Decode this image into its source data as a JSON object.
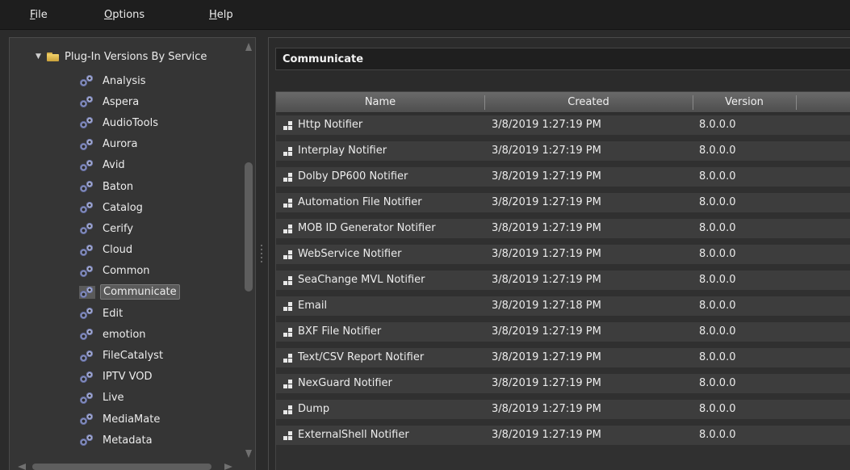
{
  "menu": {
    "file": "F",
    "file_rest": "ile",
    "options": "O",
    "options_rest": "ptions",
    "help": "H",
    "help_rest": "elp"
  },
  "tree": {
    "root_label": "Plug-In Versions By Service",
    "items": [
      {
        "label": "Analysis"
      },
      {
        "label": "Aspera"
      },
      {
        "label": "AudioTools"
      },
      {
        "label": "Aurora"
      },
      {
        "label": "Avid"
      },
      {
        "label": "Baton"
      },
      {
        "label": "Catalog"
      },
      {
        "label": "Cerify"
      },
      {
        "label": "Cloud"
      },
      {
        "label": "Common"
      },
      {
        "label": "Communicate",
        "selected": true
      },
      {
        "label": "Edit"
      },
      {
        "label": "emotion"
      },
      {
        "label": "FileCatalyst"
      },
      {
        "label": "IPTV VOD"
      },
      {
        "label": "Live"
      },
      {
        "label": "MediaMate"
      },
      {
        "label": "Metadata"
      }
    ]
  },
  "panel": {
    "title": "Communicate"
  },
  "grid": {
    "columns": [
      "Name",
      "Created",
      "Version"
    ],
    "rows": [
      {
        "name": "Http Notifier",
        "created": "3/8/2019 1:27:19 PM",
        "version": "8.0.0.0"
      },
      {
        "name": "Interplay Notifier",
        "created": "3/8/2019 1:27:19 PM",
        "version": "8.0.0.0"
      },
      {
        "name": "Dolby DP600 Notifier",
        "created": "3/8/2019 1:27:19 PM",
        "version": "8.0.0.0"
      },
      {
        "name": "Automation File Notifier",
        "created": "3/8/2019 1:27:19 PM",
        "version": "8.0.0.0"
      },
      {
        "name": "MOB ID Generator Notifier",
        "created": "3/8/2019 1:27:19 PM",
        "version": "8.0.0.0"
      },
      {
        "name": "WebService Notifier",
        "created": "3/8/2019 1:27:19 PM",
        "version": "8.0.0.0"
      },
      {
        "name": "SeaChange MVL Notifier",
        "created": "3/8/2019 1:27:19 PM",
        "version": "8.0.0.0"
      },
      {
        "name": "Email",
        "created": "3/8/2019 1:27:18 PM",
        "version": "8.0.0.0"
      },
      {
        "name": "BXF File Notifier",
        "created": "3/8/2019 1:27:19 PM",
        "version": "8.0.0.0"
      },
      {
        "name": "Text/CSV Report Notifier",
        "created": "3/8/2019 1:27:19 PM",
        "version": "8.0.0.0"
      },
      {
        "name": "NexGuard Notifier",
        "created": "3/8/2019 1:27:19 PM",
        "version": "8.0.0.0"
      },
      {
        "name": "Dump",
        "created": "3/8/2019 1:27:19 PM",
        "version": "8.0.0.0"
      },
      {
        "name": "ExternalShell Notifier",
        "created": "3/8/2019 1:27:19 PM",
        "version": "8.0.0.0"
      }
    ]
  }
}
